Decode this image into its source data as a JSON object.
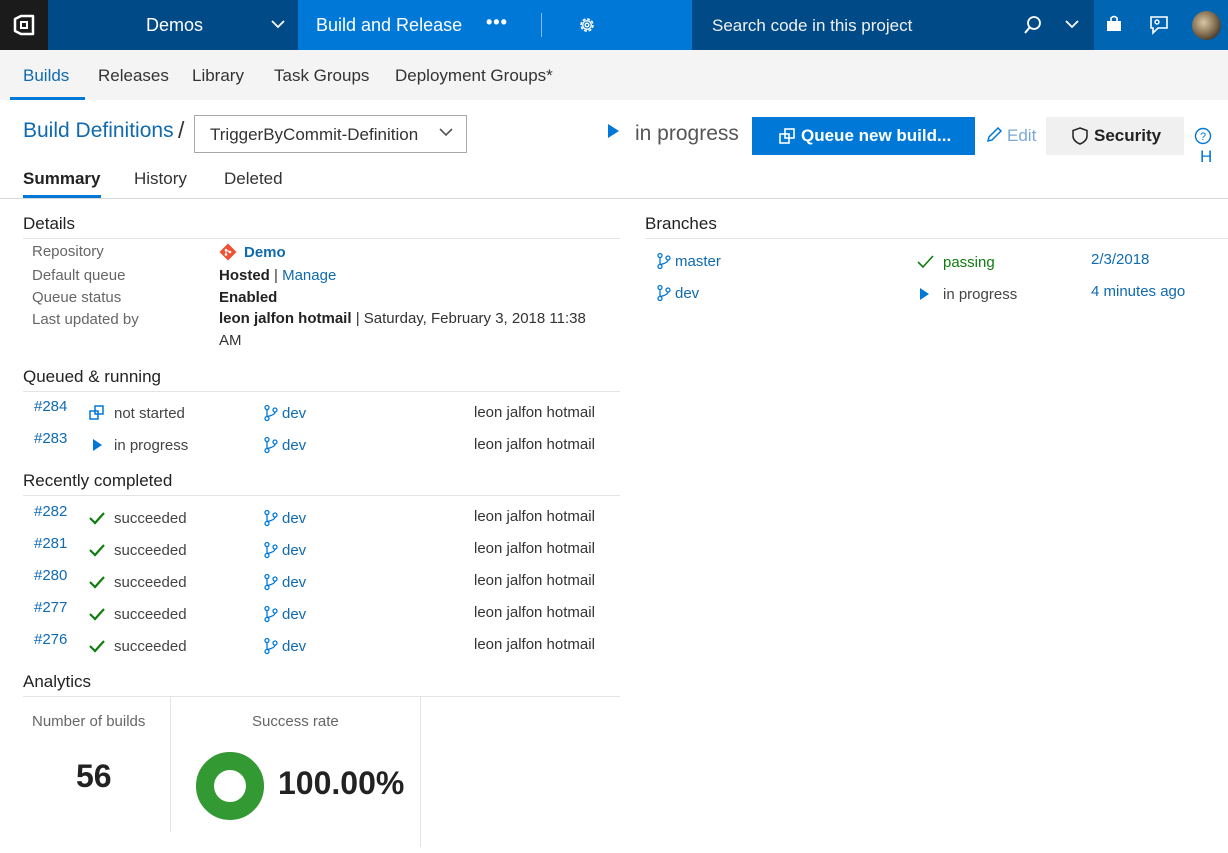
{
  "header": {
    "project": "Demos",
    "hub": "Build and Release",
    "more": "•••",
    "search_placeholder": "Search code in this project"
  },
  "subnav": {
    "tabs": [
      "Builds",
      "Releases",
      "Library",
      "Task Groups",
      "Deployment Groups*"
    ]
  },
  "page": {
    "breadcrumb": "Build Definitions",
    "slash": "/",
    "definition": "TriggerByCommit-Definition",
    "status": "in progress",
    "queue_button": "Queue new build...",
    "edit": "Edit",
    "security": "Security",
    "help": "H"
  },
  "tabs": [
    "Summary",
    "History",
    "Deleted"
  ],
  "details": {
    "title": "Details",
    "repository_label": "Repository",
    "repository": "Demo",
    "default_queue_label": "Default queue",
    "default_queue": "Hosted",
    "queue_sep": "|",
    "manage": "Manage",
    "queue_status_label": "Queue status",
    "queue_status": "Enabled",
    "last_updated_label": "Last updated by",
    "last_updated_by": "leon jalfon hotmail",
    "last_updated_date": "| Saturday, February 3, 2018 11:38",
    "last_updated_date2": "AM"
  },
  "queued": {
    "title": "Queued & running",
    "rows": [
      {
        "num": "#284",
        "status": "not started",
        "branch": "dev",
        "user": "leon jalfon hotmail"
      },
      {
        "num": "#283",
        "status": "in progress",
        "branch": "dev",
        "user": "leon jalfon hotmail"
      }
    ]
  },
  "completed": {
    "title": "Recently completed",
    "rows": [
      {
        "num": "#282",
        "status": "succeeded",
        "branch": "dev",
        "user": "leon jalfon hotmail"
      },
      {
        "num": "#281",
        "status": "succeeded",
        "branch": "dev",
        "user": "leon jalfon hotmail"
      },
      {
        "num": "#280",
        "status": "succeeded",
        "branch": "dev",
        "user": "leon jalfon hotmail"
      },
      {
        "num": "#277",
        "status": "succeeded",
        "branch": "dev",
        "user": "leon jalfon hotmail"
      },
      {
        "num": "#276",
        "status": "succeeded",
        "branch": "dev",
        "user": "leon jalfon hotmail"
      }
    ]
  },
  "analytics": {
    "title": "Analytics",
    "builds_label": "Number of builds",
    "builds": "56",
    "success_label": "Success rate",
    "success_rate": "100.00%",
    "success_fraction": 1.0
  },
  "branches": {
    "title": "Branches",
    "rows": [
      {
        "name": "master",
        "status": "passing",
        "time": "2/3/2018"
      },
      {
        "name": "dev",
        "status": "in progress",
        "time": "4 minutes ago"
      }
    ]
  },
  "colors": {
    "accent": "#0078d7",
    "success": "#107c10",
    "donut": "#339933",
    "git": "#f05133"
  }
}
